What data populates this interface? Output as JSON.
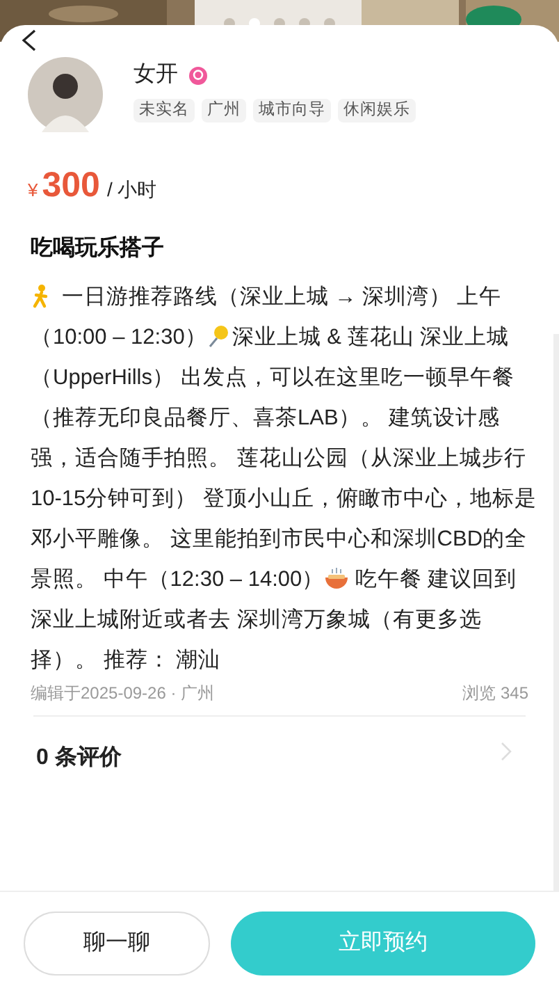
{
  "header": {
    "dots": [
      {
        "selected": false
      },
      {
        "selected": true
      },
      {
        "selected": false
      },
      {
        "selected": false
      },
      {
        "selected": false
      }
    ]
  },
  "profile": {
    "name": "女开",
    "tags": [
      "未实名",
      "广州",
      "城市向导",
      "休闲娱乐"
    ]
  },
  "price": {
    "currency": "¥",
    "amount": "300",
    "unit": "/ 小时"
  },
  "title": "吃喝玩乐搭子",
  "description": [
    [
      {
        "kind": "walker"
      },
      {
        "kind": "text",
        "text": " 一日游推荐路线（深业上城 → 深圳湾） 上午"
      }
    ],
    [
      {
        "kind": "text",
        "text": "（10:00 – 12:30）"
      },
      {
        "kind": "pin"
      },
      {
        "kind": "text",
        "text": "深业上城 & 莲花山 深业上城"
      }
    ],
    [
      {
        "kind": "text",
        "text": "（UpperHills） 出发点，可以在这里吃一顿早午餐"
      }
    ],
    [
      {
        "kind": "text",
        "text": "（推荐无印良品餐厅、喜茶LAB）。 建筑设计感"
      }
    ],
    [
      {
        "kind": "text",
        "text": "强，适合随手拍照。 莲花山公园（从深业上城步行"
      }
    ],
    [
      {
        "kind": "text",
        "text": "10-15分钟可到） 登顶小山丘，俯瞰市中心，地标是"
      }
    ],
    [
      {
        "kind": "text",
        "text": "邓小平雕像。 这里能拍到市民中心和深圳CBD的全"
      }
    ],
    [
      {
        "kind": "text",
        "text": "景照。 中午（12:30 – 14:00）"
      },
      {
        "kind": "bowl"
      },
      {
        "kind": "text",
        "text": " 吃午餐 建议回到"
      }
    ],
    [
      {
        "kind": "text",
        "text": "深业上城附近或者去 深圳湾万象城（有更多选"
      }
    ],
    [
      {
        "kind": "text",
        "text": "择）。 推荐： 潮汕"
      }
    ]
  ],
  "meta": {
    "edited": "编辑于2025-09-26 · 广州",
    "views": "浏览 345"
  },
  "reviews": {
    "label": "0 条评价"
  },
  "actions": [
    {
      "kind": "secondary",
      "label": "聊一聊"
    },
    {
      "kind": "primary",
      "label": "立即预约"
    }
  ]
}
